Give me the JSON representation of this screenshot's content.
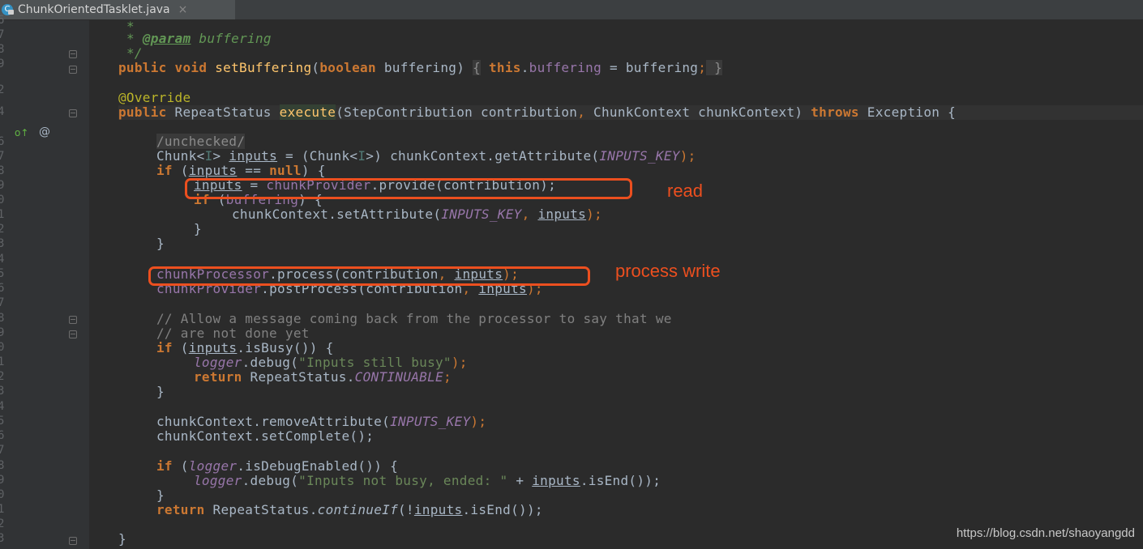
{
  "tab": {
    "filename": "ChunkOrientedTasklet.java",
    "file_icon": "java-class-icon",
    "close_symbol": "×"
  },
  "gutter": {
    "line_numbers": [
      "6",
      "7",
      "8",
      "9",
      "",
      "2",
      "4",
      "",
      "6",
      "7",
      "8",
      "9",
      "0",
      "1",
      "2",
      "3",
      "4",
      "5",
      "6",
      "7",
      "8",
      "9",
      "0",
      "1",
      "2",
      "3",
      "4",
      "5",
      "6",
      "7",
      "8",
      "9",
      "0",
      "1",
      "2",
      "3"
    ],
    "implements_marker": "o↑",
    "override_marker": "@"
  },
  "code": {
    "line_7_star": "*",
    "line_8_param_tag": "@param",
    "line_8_param_name": " buffering",
    "line_9_close": "*/",
    "setbuffering": {
      "public": "public",
      "void": "void",
      "name": "setBuffering",
      "lp": "(",
      "bool": "boolean",
      "rest": " buffering) ",
      "open": "{",
      "this": "this",
      "dot": ".",
      "field": "buffering",
      "assign": " = buffering",
      "semi": ";",
      "close": " }"
    },
    "override": "@Override",
    "execute": {
      "public": "public",
      "type": " RepeatStatus ",
      "name": "execute",
      "args1": "(StepContribution contribution",
      "comma": ",",
      "args2": " ChunkContext chunkContext) ",
      "throws": "throws",
      "exc": " Exception {"
    },
    "unchecked": "/unchecked/",
    "chunk_line": {
      "a": "Chunk<",
      "tp": "I",
      "b": "> ",
      "inputs": "inputs",
      "c": " = (Chunk<",
      "tp2": "I",
      "d": ">) chunkContext.getAttribute(",
      "key": "INPUTS_KEY",
      "e": ");"
    },
    "if_null": {
      "if": "if",
      "a": " (",
      "inputs": "inputs",
      "b": " == ",
      "null": "null",
      "c": ") {"
    },
    "provide": {
      "inputs": "inputs",
      "a": " = ",
      "prov": "chunkProvider",
      "b": ".provide(contribution);"
    },
    "if_buffering": {
      "if": "if",
      "a": " (",
      "buf": "buffering",
      "b": ") {"
    },
    "set_attr": {
      "a": "chunkContext.setAttribute(",
      "key": "INPUTS_KEY",
      "comma": ",",
      "inputs": "inputs",
      "b": ");"
    },
    "close_brace": "}",
    "process": {
      "proc": "chunkProcessor",
      "a": ".process(contribution",
      "comma": ",",
      "inputs": "inputs",
      "b": ");"
    },
    "postprocess": {
      "prov": "chunkProvider",
      "a": ".postProcess(contribution",
      "comma": ",",
      "inputs": "inputs",
      "b": ");"
    },
    "comment1": "// Allow a message coming back from the processor to say that we",
    "comment2": "// are not done yet",
    "if_busy": {
      "if": "if",
      "a": " (",
      "inputs": "inputs",
      "b": ".isBusy()) {"
    },
    "debug_busy": {
      "logger": "logger",
      "a": ".debug(",
      "str": "\"Inputs still busy\"",
      "b": ");"
    },
    "return_cont": {
      "ret": "return",
      "a": " RepeatStatus.",
      "cst": "CONTINUABLE",
      "b": ";"
    },
    "remove_attr": {
      "a": "chunkContext.removeAttribute(",
      "key": "INPUTS_KEY",
      "b": ");"
    },
    "set_complete": "chunkContext.setComplete();",
    "if_debug": {
      "if": "if",
      "a": " (",
      "logger": "logger",
      "b": ".isDebugEnabled()) {"
    },
    "debug_end": {
      "logger": "logger",
      "a": ".debug(",
      "str": "\"Inputs not busy, ended: \"",
      "b": " + ",
      "inputs": "inputs",
      "c": ".isEnd());"
    },
    "return_if": {
      "ret": "return",
      "a": " RepeatStatus.",
      "m": "continueIf",
      "b": "(!",
      "inputs": "inputs",
      "c": ".isEnd());"
    },
    "final_brace": "}"
  },
  "annotations": {
    "read": "read",
    "process_write": "process write",
    "color": "#ec4f1f"
  },
  "watermark": "https://blog.csdn.net/shaoyangdd"
}
